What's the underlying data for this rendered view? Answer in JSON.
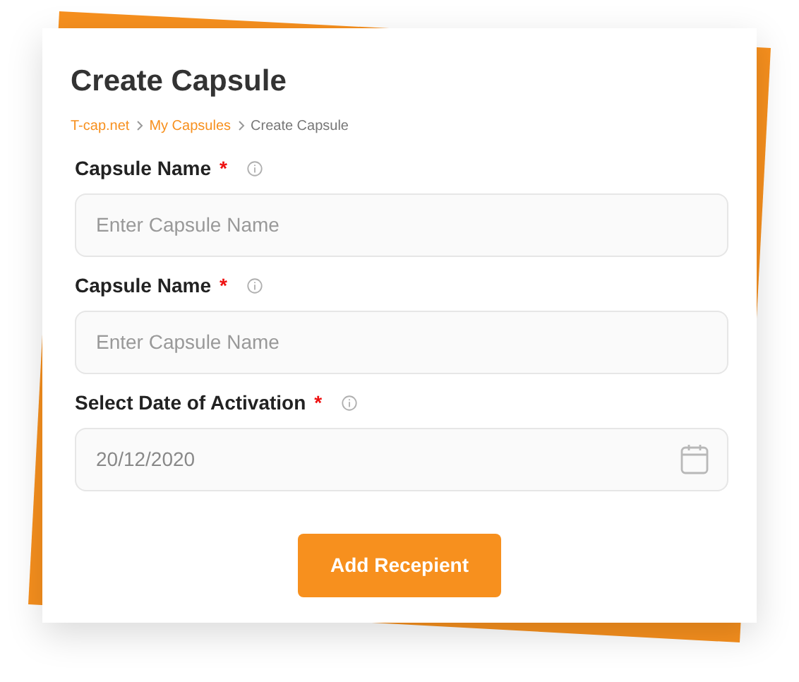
{
  "title": "Create Capsule",
  "breadcrumb": [
    {
      "label": "T-cap.net",
      "current": false
    },
    {
      "label": "My Capsules",
      "current": false
    },
    {
      "label": "Create Capsule",
      "current": true
    }
  ],
  "fields": [
    {
      "kind": "text",
      "label": "Capsule Name",
      "required_mark": "*",
      "placeholder": "Enter Capsule Name"
    },
    {
      "kind": "text",
      "label": "Capsule Name",
      "required_mark": "*",
      "placeholder": "Enter Capsule Name"
    },
    {
      "kind": "date",
      "label": "Select Date of Activation",
      "required_mark": "*",
      "value": "20/12/2020"
    }
  ],
  "button": "Add Recepient"
}
